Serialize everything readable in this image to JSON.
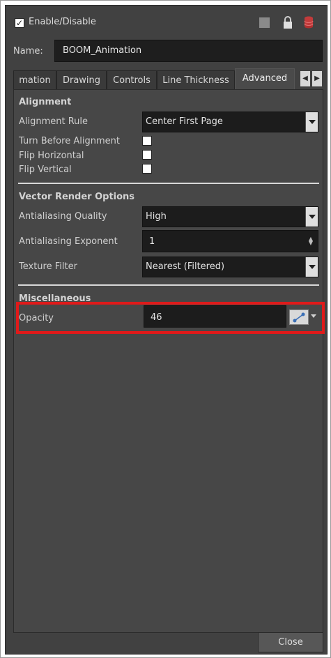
{
  "header": {
    "enable_label": "Enable/Disable",
    "enable_checked": true,
    "icons": [
      "color-swatch-icon",
      "lock-icon",
      "database-icon"
    ]
  },
  "name": {
    "label": "Name:",
    "value": "BOOM_Animation"
  },
  "tabs": [
    {
      "label": "mation",
      "active": false
    },
    {
      "label": "Drawing",
      "active": false
    },
    {
      "label": "Controls",
      "active": false
    },
    {
      "label": "Line Thickness",
      "active": false
    },
    {
      "label": "Advanced",
      "active": true
    }
  ],
  "alignment": {
    "title": "Alignment",
    "rule_label": "Alignment Rule",
    "rule_value": "Center First Page",
    "turn_label": "Turn Before Alignment",
    "flip_h_label": "Flip Horizontal",
    "flip_v_label": "Flip Vertical"
  },
  "vector": {
    "title": "Vector Render Options",
    "aa_quality_label": "Antialiasing Quality",
    "aa_quality_value": "High",
    "aa_exponent_label": "Antialiasing Exponent",
    "aa_exponent_value": "1",
    "texture_label": "Texture Filter",
    "texture_value": "Nearest (Filtered)"
  },
  "misc": {
    "title": "Miscellaneous",
    "opacity_label": "Opacity",
    "opacity_value": "46"
  },
  "footer": {
    "close_label": "Close"
  },
  "colors": {
    "window_bg": "#414141",
    "field_bg": "#1c1c1c",
    "highlight": "#e01a1a"
  }
}
